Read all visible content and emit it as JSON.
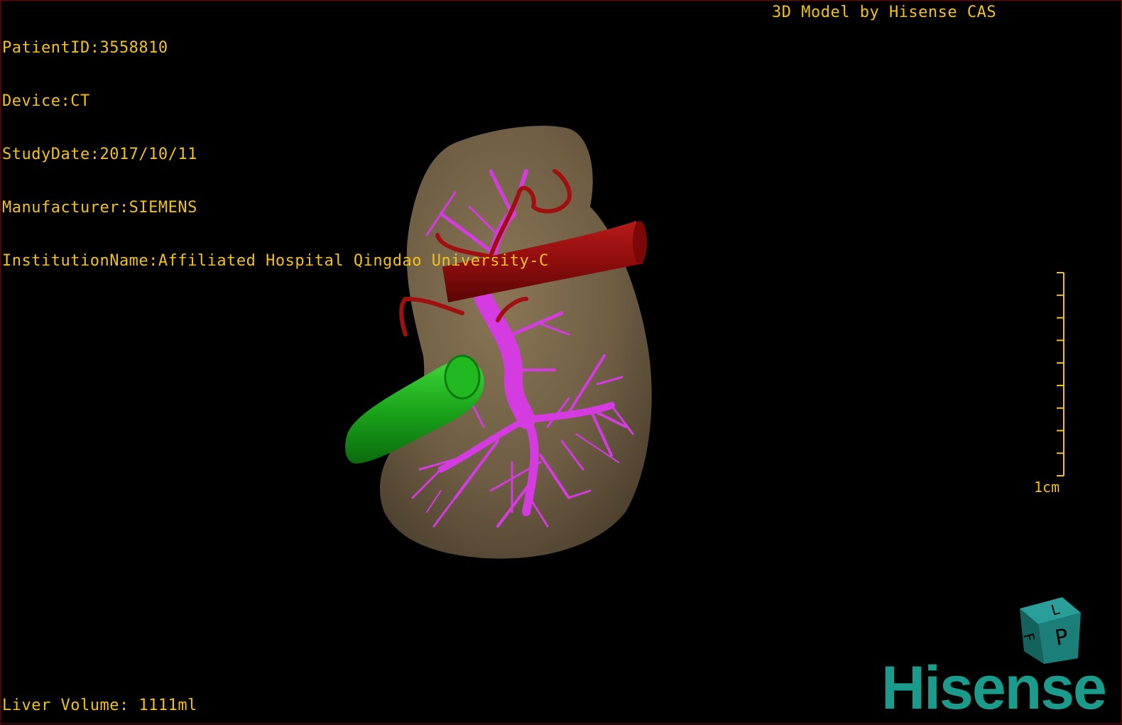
{
  "patient_info": {
    "patient_id": "PatientID:3558810",
    "device": "Device:CT",
    "study_date": "StudyDate:2017/10/11",
    "manufacturer": "Manufacturer:SIEMENS",
    "institution": "InstitutionName:Affiliated Hospital Qingdao University-C"
  },
  "brand_caption": "3D Model by Hisense CAS",
  "liver_volume": "Liver Volume: 1111ml",
  "scale": {
    "label": "1cm",
    "ticks": 10
  },
  "orientation_cube": {
    "face_top": "L",
    "face_front": "P",
    "face_side": "F"
  },
  "logo": "Hisense",
  "colors": {
    "overlay_text": "#f2c21a",
    "liver": "#6e5d44",
    "portal_vein": "#d43be0",
    "vena_cava": "#8f0d0d",
    "gallbladder": "#19a31a",
    "brand": "#1a9b8c",
    "frame": "#7a0000"
  }
}
